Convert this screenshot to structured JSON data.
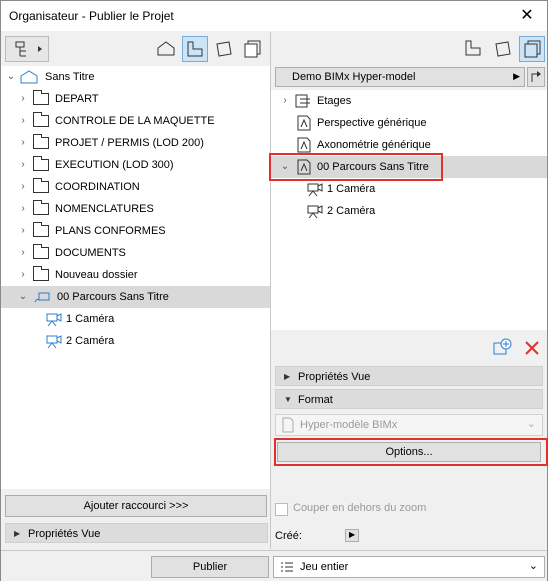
{
  "window": {
    "title": "Organisateur - Publier le Projet",
    "close_glyph": "✕"
  },
  "left": {
    "root": {
      "label": "Sans Titre"
    },
    "items": [
      {
        "label": "DEPART"
      },
      {
        "label": "CONTROLE DE LA MAQUETTE"
      },
      {
        "label": "PROJET / PERMIS (LOD 200)"
      },
      {
        "label": "EXECUTION (LOD 300)"
      },
      {
        "label": "COORDINATION"
      },
      {
        "label": "NOMENCLATURES"
      },
      {
        "label": "PLANS CONFORMES"
      },
      {
        "label": "DOCUMENTS"
      },
      {
        "label": "Nouveau dossier"
      }
    ],
    "parcours": {
      "label": "00 Parcours Sans Titre"
    },
    "cameras": [
      {
        "label": "1 Caméra"
      },
      {
        "label": "2 Caméra"
      }
    ],
    "add_shortcut_label": "Ajouter raccourci >>>",
    "props_label": "Propriétés Vue"
  },
  "right": {
    "dropdown_label": "Demo BIMx Hyper-model",
    "items": [
      {
        "label": "Etages"
      },
      {
        "label": "Perspective générique"
      },
      {
        "label": "Axonométrie générique"
      }
    ],
    "parcours": {
      "label": "00 Parcours Sans Titre"
    },
    "cameras": [
      {
        "label": "1 Caméra"
      },
      {
        "label": "2 Caméra"
      }
    ],
    "props_label": "Propriétés Vue",
    "format_label": "Format",
    "format_value": "Hyper-modèle BIMx",
    "options_label": "Options...",
    "crop_label": "Couper en dehors  du zoom",
    "created_label": "Créé:"
  },
  "bottom": {
    "publish_label": "Publier",
    "scope_value": "Jeu entier"
  },
  "colors": {
    "accent": "#2a7fd4",
    "highlight": "#e03030",
    "selection": "#d9d9d9"
  }
}
